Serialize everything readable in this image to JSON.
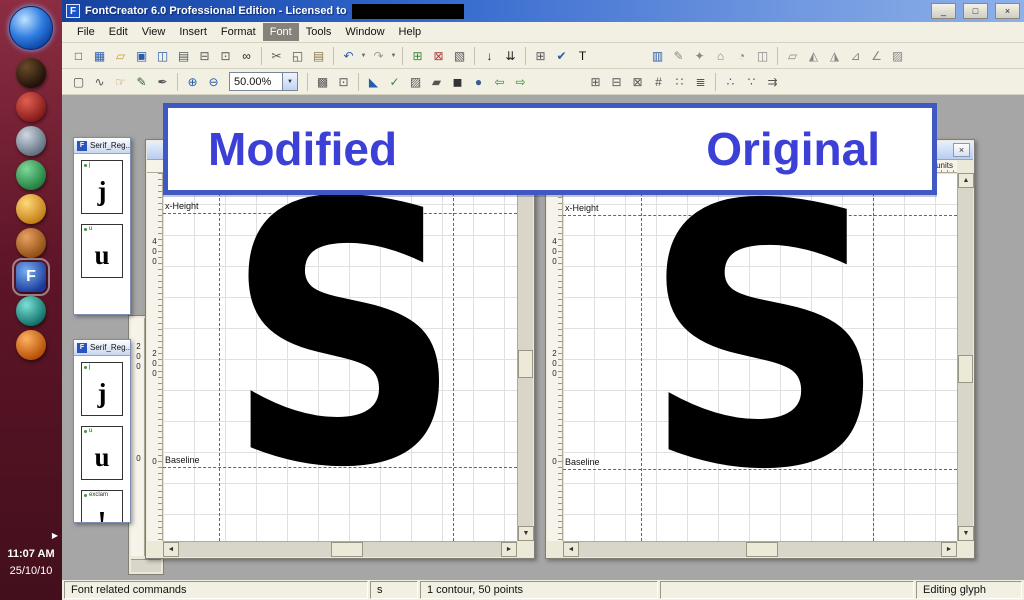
{
  "window": {
    "app_icon_glyph": "F",
    "title": "FontCreator 6.0 Professional Edition - Licensed to",
    "buttons": {
      "minimize": "_",
      "maximize": "□",
      "close": "×"
    }
  },
  "menu": {
    "items": [
      "File",
      "Edit",
      "View",
      "Insert",
      "Format",
      "Font",
      "Tools",
      "Window",
      "Help"
    ],
    "active": "Font"
  },
  "toolbar1": {
    "items": [
      {
        "name": "new-font",
        "glyph": "□",
        "color": "#444444"
      },
      {
        "name": "font-overview",
        "glyph": "▦",
        "color": "#2a5caa"
      },
      {
        "name": "open-font",
        "glyph": "▱",
        "color": "#c89b3c"
      },
      {
        "name": "save-font",
        "glyph": "▣",
        "color": "#2a5caa"
      },
      {
        "name": "save-all",
        "glyph": "◫",
        "color": "#2a5caa"
      },
      {
        "name": "export-font",
        "glyph": "▤",
        "color": "#555555"
      },
      {
        "name": "print",
        "glyph": "⊟",
        "color": "#555555"
      },
      {
        "name": "print-preview",
        "glyph": "⊡",
        "color": "#555555"
      },
      {
        "name": "find-glyph",
        "glyph": "∞",
        "color": "#222222"
      },
      {
        "type": "sep"
      },
      {
        "name": "cut",
        "glyph": "✂",
        "color": "#555555"
      },
      {
        "name": "copy",
        "glyph": "◱",
        "color": "#555555"
      },
      {
        "name": "paste",
        "glyph": "▤",
        "color": "#8a7a4a"
      },
      {
        "type": "sep"
      },
      {
        "name": "undo",
        "glyph": "↶",
        "color": "#2a5caa",
        "dropdown": true
      },
      {
        "name": "redo",
        "glyph": "↷",
        "color": "#9a9a9a",
        "dropdown": true
      },
      {
        "type": "sep"
      },
      {
        "name": "insert-glyph",
        "glyph": "⊞",
        "color": "#3a8a3a"
      },
      {
        "name": "delete-glyph",
        "glyph": "⊠",
        "color": "#b03a3a"
      },
      {
        "name": "glyph-properties",
        "glyph": "▧",
        "color": "#555555"
      },
      {
        "type": "sep"
      },
      {
        "name": "sort-glyphs",
        "glyph": "↓",
        "color": "#222222"
      },
      {
        "name": "autonaming",
        "glyph": "⇊",
        "color": "#222222"
      },
      {
        "type": "sep"
      },
      {
        "name": "codepage-mapping",
        "glyph": "⊞",
        "color": "#555555"
      },
      {
        "name": "validate-font",
        "glyph": "✔",
        "color": "#2a5caa"
      },
      {
        "name": "test-font",
        "glyph": "T",
        "color": "#111111"
      },
      {
        "type": "gap"
      },
      {
        "name": "toggle-overview-panel",
        "glyph": "▥",
        "color": "#2a5caa"
      },
      {
        "name": "toggle-background-image",
        "glyph": "✎",
        "color": "#888888"
      },
      {
        "name": "toggle-transform-panel",
        "glyph": "✦",
        "color": "#888888"
      },
      {
        "name": "toggle-metrics-panel",
        "glyph": "⌂",
        "color": "#888888"
      },
      {
        "name": "toggle-kerning-panel",
        "glyph": "◔",
        "color": "#888888"
      },
      {
        "name": "toggle-comparison-panel",
        "glyph": "◫",
        "color": "#888888"
      },
      {
        "type": "sep"
      },
      {
        "name": "transform-skew",
        "glyph": "▱",
        "color": "#888888"
      },
      {
        "name": "transform-rotate",
        "glyph": "◭",
        "color": "#888888"
      },
      {
        "name": "transform-mirror",
        "glyph": "◮",
        "color": "#888888"
      },
      {
        "name": "transform-slant",
        "glyph": "⊿",
        "color": "#888888"
      },
      {
        "name": "transform-scale",
        "glyph": "∠",
        "color": "#888888"
      },
      {
        "name": "toggle-preview-panel",
        "glyph": "▨",
        "color": "#888888"
      }
    ]
  },
  "toolbar2": {
    "zoom_value": "50.00%",
    "items": [
      {
        "name": "edit-tool",
        "glyph": "▢",
        "color": "#555555"
      },
      {
        "name": "lasso-tool",
        "glyph": "∿",
        "color": "#555555"
      },
      {
        "name": "hand-tool",
        "glyph": "☞",
        "color": "#b08a50"
      },
      {
        "name": "draw-contours-tool",
        "glyph": "✎",
        "color": "#336633"
      },
      {
        "name": "knife-tool",
        "glyph": "✒",
        "color": "#555555"
      },
      {
        "type": "sep"
      },
      {
        "name": "zoom-in",
        "glyph": "⊕",
        "color": "#2a5caa"
      },
      {
        "name": "zoom-out",
        "glyph": "⊖",
        "color": "#2a5caa"
      },
      {
        "type": "zoom"
      },
      {
        "type": "sep"
      },
      {
        "name": "zoom-rectangle",
        "glyph": "▩",
        "color": "#555555"
      },
      {
        "name": "zoom-to-glyph",
        "glyph": "⊡",
        "color": "#555555"
      },
      {
        "type": "sep"
      },
      {
        "name": "contour-direction",
        "glyph": "◣",
        "color": "#2a5caa"
      },
      {
        "name": "validate-contour",
        "glyph": "✓",
        "color": "#3a8a3a"
      },
      {
        "name": "join-contours",
        "glyph": "▨",
        "color": "#555555"
      },
      {
        "name": "outline-mode",
        "glyph": "▰",
        "color": "#555555"
      },
      {
        "name": "fill-mode",
        "glyph": "◼",
        "color": "#333333"
      },
      {
        "name": "curve-mode",
        "glyph": "●",
        "color": "#3a5a9a"
      },
      {
        "name": "previous-glyph",
        "glyph": "⇦",
        "color": "#2a8a2a"
      },
      {
        "name": "next-glyph",
        "glyph": "⇨",
        "color": "#2a8a2a"
      },
      {
        "type": "gap"
      },
      {
        "name": "show-grid",
        "glyph": "⊞",
        "color": "#555555"
      },
      {
        "name": "show-guidelines",
        "glyph": "⊟",
        "color": "#555555"
      },
      {
        "name": "show-metric-lines",
        "glyph": "⊠",
        "color": "#555555"
      },
      {
        "name": "snap-to-grid",
        "glyph": "#",
        "color": "#555555"
      },
      {
        "name": "snap-to-guidelines",
        "glyph": "∷",
        "color": "#555555"
      },
      {
        "name": "snap-to-metrics",
        "glyph": "≣",
        "color": "#555555"
      },
      {
        "type": "sep"
      },
      {
        "name": "show-points",
        "glyph": "∴",
        "color": "#2a5caa"
      },
      {
        "name": "show-point-numbers",
        "glyph": "∵",
        "color": "#555555"
      },
      {
        "name": "show-directions",
        "glyph": "⇉",
        "color": "#555555"
      }
    ]
  },
  "annotation": {
    "modified_label": "Modified",
    "original_label": "Original"
  },
  "glyph_windows": [
    {
      "id": "modified",
      "glyph": "S",
      "x_height_label": "x-Height",
      "baseline_label": "Baseline",
      "ruler_values": [
        "400",
        "200",
        "0"
      ],
      "close_glyph": "×"
    },
    {
      "id": "original",
      "glyph": "S",
      "x_height_label": "x-Height",
      "baseline_label": "Baseline",
      "ruler_values": [
        "400",
        "200",
        "0"
      ],
      "units_label": "units",
      "close_glyph": "×"
    }
  ],
  "background_window": {
    "ruler_values": [
      "200",
      "0"
    ]
  },
  "palettes": [
    {
      "title": "Serif_Reg...",
      "icon_glyph": "F",
      "cells": [
        {
          "label": "j",
          "glyph": "j"
        },
        {
          "label": "u",
          "glyph": "u"
        }
      ]
    },
    {
      "title": "Serif_Reg...",
      "icon_glyph": "F",
      "cells": [
        {
          "label": "j",
          "glyph": "j"
        },
        {
          "label": "u",
          "glyph": "u"
        },
        {
          "label": "exclam",
          "glyph": "!"
        }
      ]
    }
  ],
  "statusbar": {
    "left": "Font related commands",
    "glyph_name": "s",
    "contour_info": "1 contour, 50 points",
    "mode": "Editing glyph"
  },
  "sidebar": {
    "clock": "11:07 AM",
    "date": "25/10/10",
    "icons": [
      {
        "name": "taskbar-app-icon-1",
        "color1": "#6a4a2a",
        "color2": "#1a0d05",
        "shape": "circle"
      },
      {
        "name": "taskbar-app-icon-2",
        "color1": "#e06050",
        "color2": "#801515",
        "shape": "circle"
      },
      {
        "name": "taskbar-app-icon-3",
        "color1": "#cfd8e0",
        "color2": "#5a6a7a",
        "shape": "circle"
      },
      {
        "name": "taskbar-app-icon-4",
        "color1": "#7fd89a",
        "color2": "#1a7a3a",
        "shape": "circle"
      },
      {
        "name": "taskbar-app-icon-5",
        "color1": "#ffd97a",
        "color2": "#c07a10",
        "shape": "circle"
      },
      {
        "name": "taskbar-app-icon-6",
        "color1": "#e8a060",
        "color2": "#8a4a10",
        "shape": "circle"
      },
      {
        "name": "fontcreator-taskbar-icon",
        "color1": "#7ab0f0",
        "color2": "#1a3a9a",
        "shape": "square",
        "glyph": "F",
        "active": true
      },
      {
        "name": "taskbar-app-icon-8",
        "color1": "#7ae0d8",
        "color2": "#0a6a60",
        "shape": "circle"
      },
      {
        "name": "taskbar-app-icon-9",
        "color1": "#ffb060",
        "color2": "#b04a00",
        "shape": "circle"
      }
    ]
  },
  "colors": {
    "accent_blue": "#3f58c2",
    "annotation_text": "#3c40d6",
    "guide_red": "#c43b50"
  }
}
